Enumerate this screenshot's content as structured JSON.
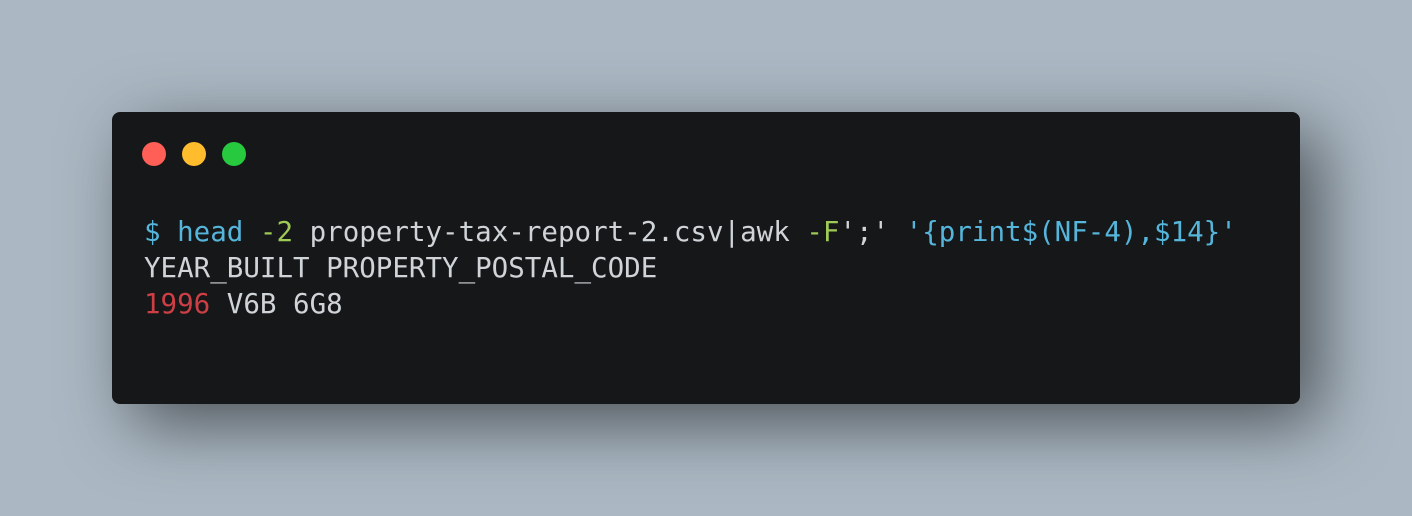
{
  "colors": {
    "background": "#abb8c3",
    "window": "#151718",
    "close": "#ff5f56",
    "minimize": "#ffbd2e",
    "zoom": "#27c93f",
    "keyword": "#55b5db",
    "option": "#9fca56",
    "text": "#d0d4d8",
    "number": "#cd3f45"
  },
  "window_controls": [
    "close",
    "minimize",
    "zoom"
  ],
  "terminal": {
    "command": {
      "prompt": "$",
      "cmd": "head",
      "opt1": "-2",
      "file": "property-tax-report-2.csv|awk",
      "opt2": "-F",
      "sep": "';'",
      "script": "'{print$(NF-4),$14}'"
    },
    "header_line": "YEAR_BUILT PROPERTY_POSTAL_CODE",
    "data_line": {
      "year": "1996",
      "postal_code": "V6B 6G8"
    }
  }
}
